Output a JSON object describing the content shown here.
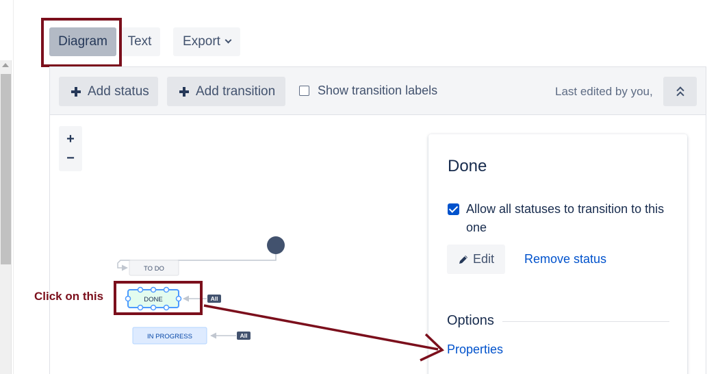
{
  "view_tabs": {
    "diagram": "Diagram",
    "text": "Text",
    "export": "Export"
  },
  "toolbar": {
    "add_status": "Add status",
    "add_transition": "Add transition",
    "show_transition_labels": "Show transition labels",
    "last_edited": "Last edited by you,"
  },
  "zoom": {
    "in": "+",
    "out": "−"
  },
  "diagram": {
    "statuses": [
      {
        "label": "TO DO"
      },
      {
        "label": "DONE"
      },
      {
        "label": "IN PROGRESS"
      }
    ],
    "all_badges": [
      "All",
      "All"
    ]
  },
  "panel": {
    "title": "Done",
    "allow_all": "Allow all statuses to transition to this one",
    "edit": "Edit",
    "remove": "Remove status",
    "options_title": "Options",
    "properties": "Properties"
  },
  "annotation": {
    "click_label": "Click on this"
  },
  "colors": {
    "highlight": "#7b0f1c",
    "link": "#0052cc",
    "selected_status_fill": "#e3fcef",
    "selected_status_border": "#4c9aff"
  }
}
